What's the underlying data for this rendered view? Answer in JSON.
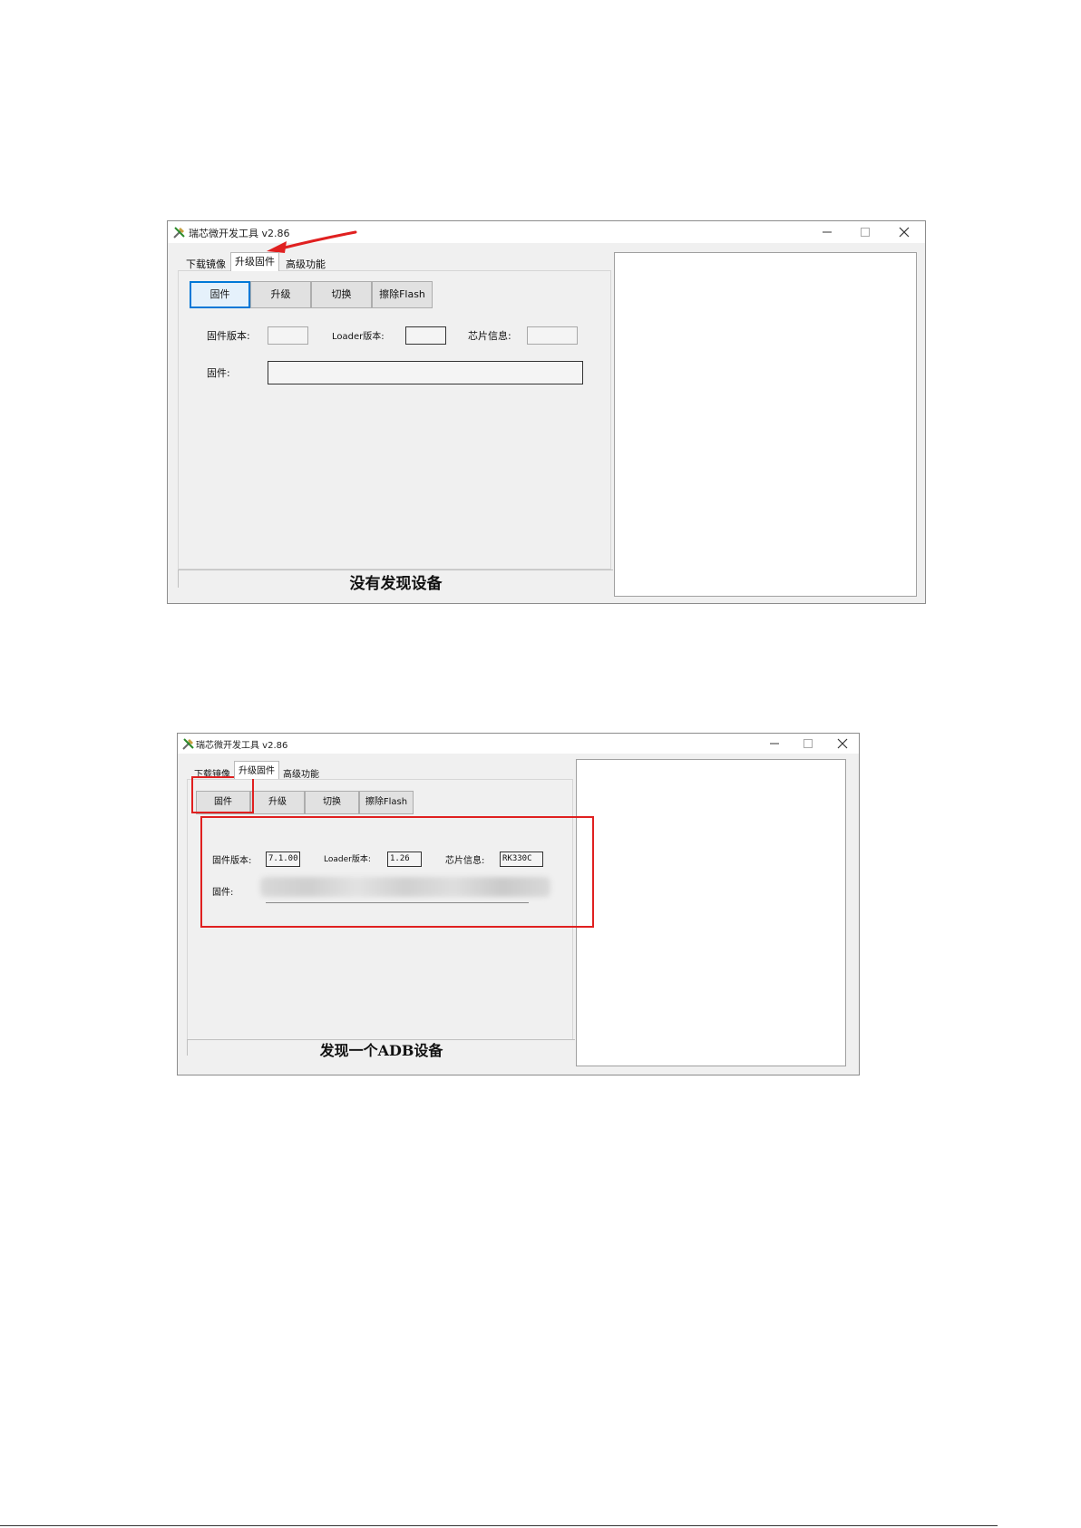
{
  "window1": {
    "title": "瑞芯微开发工具 v2.86",
    "tabs": [
      "下载镜像",
      "升级固件",
      "高级功能"
    ],
    "buttons": [
      "固件",
      "升级",
      "切换",
      "擦除Flash"
    ],
    "labels": {
      "firmware_version": "固件版本:",
      "loader_version": "Loader版本:",
      "chip_info": "芯片信息:",
      "firmware": "固件:"
    },
    "values": {
      "firmware_version": "",
      "loader_version": "",
      "chip_info": "",
      "firmware": ""
    },
    "status": "没有发现设备"
  },
  "window2": {
    "title": "瑞芯微开发工具 v2.86",
    "tabs": [
      "下载镜像",
      "升级固件",
      "高级功能"
    ],
    "buttons": [
      "固件",
      "升级",
      "切换",
      "擦除Flash"
    ],
    "labels": {
      "firmware_version": "固件版本:",
      "loader_version": "Loader版本:",
      "chip_info": "芯片信息:",
      "firmware": "固件:"
    },
    "values": {
      "firmware_version": "7.1.00",
      "loader_version": "1.26",
      "chip_info": "RK330C"
    },
    "status": "发现一个ADB设备"
  },
  "colors": {
    "annotation": "#e02020",
    "focus": "#0078d7"
  },
  "icons": [
    "tools-icon",
    "minimize-icon",
    "maximize-icon",
    "close-icon",
    "red-arrow-icon"
  ]
}
